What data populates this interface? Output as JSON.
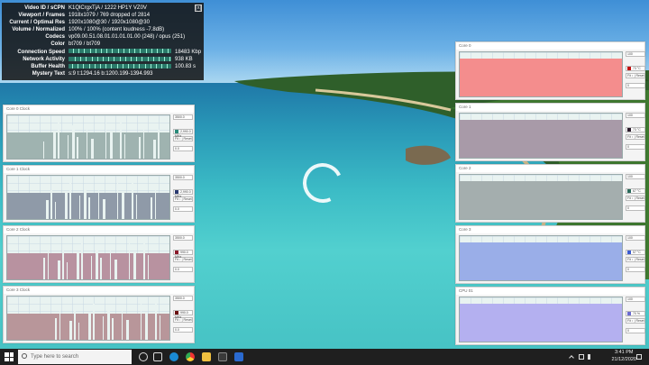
{
  "stats": {
    "close_label": "[x]",
    "rows": [
      {
        "k": "Video ID / sCPN",
        "v": "K1QlCrgxTjA / 1222 HP1Y VZ0V"
      },
      {
        "k": "Viewport / Frames",
        "v": "1918x1079 / 769 dropped of 2814"
      },
      {
        "k": "Current / Optimal Res",
        "v": "1920x1080@30 / 1920x1080@30"
      },
      {
        "k": "Volume / Normalized",
        "v": "100% / 100% (content loudness -7.8dB)"
      },
      {
        "k": "Codecs",
        "v": "vp09.00.51.08.01.01.01.01.00 (248) / opus (251)"
      },
      {
        "k": "Color",
        "v": "bt709 / bt709"
      },
      {
        "k": "Connection Speed",
        "v": "18483 Kbps",
        "bar": true
      },
      {
        "k": "Network Activity",
        "v": "938 KB",
        "bar": true
      },
      {
        "k": "Buffer Health",
        "v": "100.83 s",
        "bar": true
      },
      {
        "k": "Mystery Text",
        "v": "s:9 t:1294.16 b:1200.199-1394.993"
      }
    ]
  },
  "left_graphs": [
    {
      "title": "Core 0 Clock",
      "max": "3500.0",
      "value": "2,990.0 MHz",
      "btn": "Fit ↕ | Reset",
      "min": "0.0",
      "color": "#9fb3b0",
      "swatch": "#2a8a7a"
    },
    {
      "title": "Core 1 Clock",
      "max": "3500.0",
      "value": "2,990.0 MHz",
      "btn": "Fit ↕ | Reset",
      "min": "0.0",
      "color": "#8f9aa8",
      "swatch": "#2a3a70"
    },
    {
      "title": "Core 2 Clock",
      "max": "3500.0",
      "value": "990.0 MHz",
      "btn": "Fit ↕ | Reset",
      "min": "0.0",
      "color": "#b892a0",
      "swatch": "#8a1a2a"
    },
    {
      "title": "Core 3 Clock",
      "max": "3500.0",
      "value": "990.0 MHz",
      "btn": "Fit ↕ | Reset",
      "min": "0.0",
      "color": "#b8969a",
      "swatch": "#6a1010"
    }
  ],
  "right_graphs": [
    {
      "title": "Core 0",
      "max": "100",
      "value": "73 °C",
      "btn": "Fit ↕ | Reset",
      "min": "0",
      "color": "#f48d8d",
      "swatch": "#c01010"
    },
    {
      "title": "Core 1",
      "max": "100",
      "value": "73 °C",
      "btn": "Fit ↕ | Reset",
      "min": "0",
      "color": "#a89aa8",
      "swatch": "#2a1a2a"
    },
    {
      "title": "Core 2",
      "max": "100",
      "value": "67 °C",
      "btn": "Fit ↕ | Reset",
      "min": "0",
      "color": "#a4aeae",
      "swatch": "#2a6a5a"
    },
    {
      "title": "Core 3",
      "max": "100",
      "value": "57 °C",
      "btn": "Fit ↕ | Reset",
      "min": "0",
      "color": "#9aaee8",
      "swatch": "#3a5ad0"
    },
    {
      "title": "CPU 01",
      "max": "100",
      "value": "70 %",
      "btn": "Fit ↕ | Reset",
      "min": "0",
      "color": "#b4b0f0",
      "swatch": "#6a6ad0"
    }
  ],
  "taskbar": {
    "search_placeholder": "Type here to search",
    "time": "3:41 PM",
    "date": "21/12/2020"
  },
  "colors": {
    "taskbar": "#1f1f1f",
    "overlay": "#141414"
  }
}
